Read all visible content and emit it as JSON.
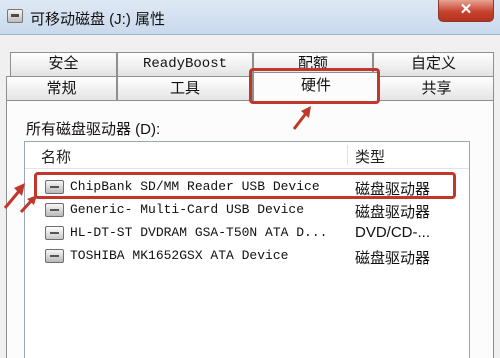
{
  "window": {
    "title": "可移动磁盘 (J:) 属性",
    "close_label": "✕"
  },
  "tabs": {
    "row1": [
      {
        "label": "安全"
      },
      {
        "label": "ReadyBoost"
      },
      {
        "label": "配额"
      },
      {
        "label": "自定义"
      }
    ],
    "row2": [
      {
        "label": "常规"
      },
      {
        "label": "工具"
      },
      {
        "label": "硬件",
        "active": true
      },
      {
        "label": "共享"
      }
    ]
  },
  "hardware": {
    "section_label": "所有磁盘驱动器 (D):",
    "columns": {
      "name": "名称",
      "type": "类型"
    },
    "devices": [
      {
        "name": "ChipBank SD/MM Reader USB Device",
        "type": "磁盘驱动器",
        "icon": "drive-icon",
        "highlighted": true
      },
      {
        "name": "Generic- Multi-Card USB Device",
        "type": "磁盘驱动器",
        "icon": "drive-icon"
      },
      {
        "name": "HL-DT-ST DVDRAM GSA-T50N ATA D...",
        "type": "DVD/CD-...",
        "icon": "optical-drive-icon"
      },
      {
        "name": "TOSHIBA MK1652GSX ATA Device",
        "type": "磁盘驱动器",
        "icon": "drive-icon"
      }
    ]
  },
  "annotation_color": "#c0372c"
}
